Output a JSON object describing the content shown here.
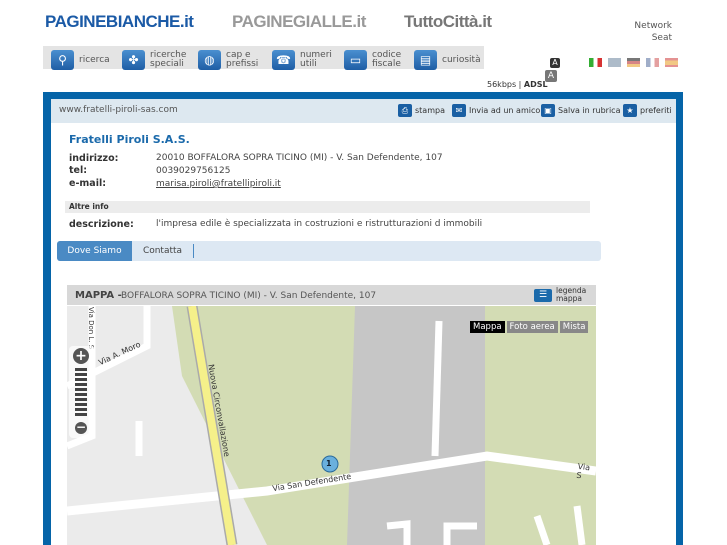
{
  "header": {
    "logos": [
      "PAGINEBIANCHE.it",
      "PAGINEGIALLE.it",
      "TuttoCittà.it"
    ],
    "network": [
      "Network",
      "Seat"
    ],
    "speed": "56kbps",
    "adsl": "ADSL",
    "font_size_icon": "A"
  },
  "nav": [
    {
      "label1": "",
      "label2": "ricerca",
      "icon": "search-icon"
    },
    {
      "label1": "ricerche",
      "label2": "speciali",
      "icon": "clover-icon"
    },
    {
      "label1": "cap e",
      "label2": "prefissi",
      "icon": "globe-icon"
    },
    {
      "label1": "numeri",
      "label2": "utili",
      "icon": "phone-icon"
    },
    {
      "label1": "codice",
      "label2": "fiscale",
      "icon": "card-icon"
    },
    {
      "label1": "",
      "label2": "curiosità",
      "icon": "book-icon"
    }
  ],
  "toolbar": {
    "url": "www.fratelli-piroli-sas.com",
    "actions": [
      "stampa",
      "Invia ad un amico",
      "Salva in rubrica",
      "preferiti"
    ]
  },
  "company": {
    "name": "Fratelli Piroli S.A.S.",
    "address_label": "indirizzo:",
    "address": "20010 BOFFALORA SOPRA TICINO (MI) - V. San Defendente, 107",
    "tel_label": "tel:",
    "tel": "0039029756125",
    "email_label": "e-mail:",
    "email": "marisa.piroli@fratellipiroli.it",
    "altre_info": "Altre info",
    "desc_label": "descrizione:",
    "desc": "l'impresa edile è specializzata in costruzioni e ristrutturazioni d immobili"
  },
  "tabs": [
    "Dove Siamo",
    "Contatta"
  ],
  "map": {
    "title": "MAPPA -",
    "address": "BOFFALORA SOPRA TICINO (MI) - V. San Defendente, 107",
    "legend1": "legenda",
    "legend2": "mappa",
    "types": [
      "Mappa",
      "Foto aerea",
      "Mista"
    ],
    "streets": [
      "Via A. Moro",
      "Nuova Circonvallazione",
      "Via San Defendente",
      "Via S",
      "Via Don L. S"
    ],
    "marker": "1"
  }
}
